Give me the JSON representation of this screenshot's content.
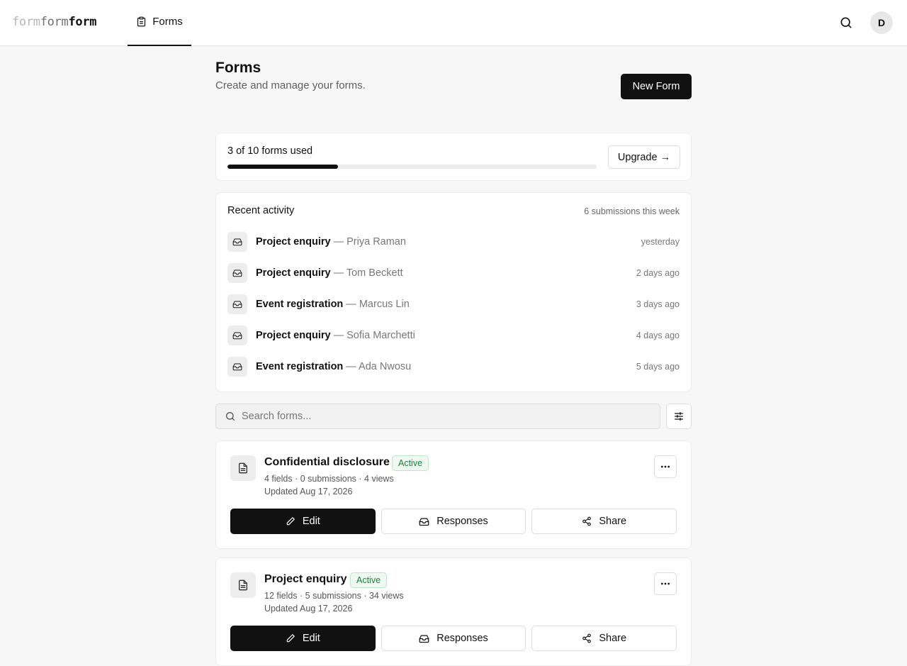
{
  "header": {
    "logo": [
      "form",
      "form",
      "form"
    ],
    "nav_tab": "Forms",
    "avatar_initial": "D"
  },
  "page": {
    "title": "Forms",
    "subtitle": "Create and manage your forms.",
    "new_button": "New Form"
  },
  "usage": {
    "label": "3 of 10 forms used",
    "used": 3,
    "limit": 10,
    "upgrade_button": "Upgrade →"
  },
  "activity": {
    "title": "Recent activity",
    "count": "6 submissions this week",
    "items": [
      {
        "form": "Project enquiry",
        "name": "Priya Raman",
        "time": "yesterday"
      },
      {
        "form": "Project enquiry",
        "name": "Tom Beckett",
        "time": "2 days ago"
      },
      {
        "form": "Event registration",
        "name": "Marcus Lin",
        "time": "3 days ago"
      },
      {
        "form": "Project enquiry",
        "name": "Sofia Marchetti",
        "time": "4 days ago"
      },
      {
        "form": "Event registration",
        "name": "Ada Nwosu",
        "time": "5 days ago"
      }
    ]
  },
  "search": {
    "placeholder": "Search forms..."
  },
  "forms": [
    {
      "name": "Confidential disclosure",
      "status": "Active",
      "meta": "4 fields · 0 submissions · 4 views",
      "updated": "Updated Aug 17, 2026",
      "edit": "Edit",
      "responses": "Responses",
      "share": "Share"
    },
    {
      "name": "Project enquiry",
      "status": "Active",
      "meta": "12 fields · 5 submissions · 34 views",
      "updated": "Updated Aug 17, 2026",
      "edit": "Edit",
      "responses": "Responses",
      "share": "Share"
    }
  ]
}
